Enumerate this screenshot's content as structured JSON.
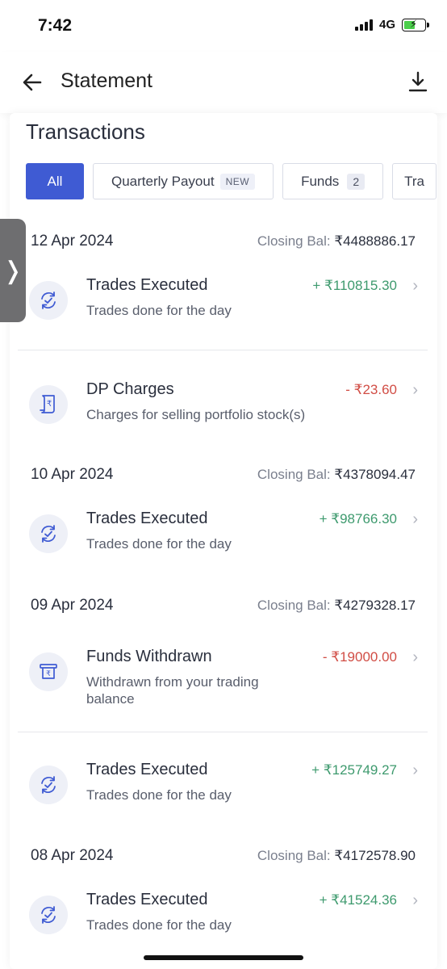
{
  "status": {
    "time": "7:42",
    "network": "4G"
  },
  "header": {
    "title": "Statement"
  },
  "section": {
    "title": "Transactions"
  },
  "filters": [
    {
      "label": "All"
    },
    {
      "label": "Quarterly Payout",
      "badge": "NEW"
    },
    {
      "label": "Funds",
      "count": "2"
    },
    {
      "label": "Tra"
    }
  ],
  "groups": [
    {
      "date": "12 Apr 2024",
      "closing_label": "Closing Bal:",
      "closing_value": "₹4488886.17",
      "items": [
        {
          "title": "Trades Executed",
          "subtitle": "Trades done for the day",
          "amount": "+ ₹110815.30",
          "icon": "trades-sync-icon"
        },
        {
          "title": "DP Charges",
          "subtitle": "Charges for selling portfolio stock(s)",
          "amount": "- ₹23.60",
          "icon": "receipt-rupee-icon"
        }
      ]
    },
    {
      "date": "10 Apr 2024",
      "closing_label": "Closing Bal:",
      "closing_value": "₹4378094.47",
      "items": [
        {
          "title": "Trades Executed",
          "subtitle": "Trades done for the day",
          "amount": "+ ₹98766.30",
          "icon": "trades-sync-icon"
        }
      ]
    },
    {
      "date": "09 Apr 2024",
      "closing_label": "Closing Bal:",
      "closing_value": "₹4279328.17",
      "items": [
        {
          "title": "Funds Withdrawn",
          "subtitle": "Withdrawn from your trading balance",
          "amount": "- ₹19000.00",
          "icon": "withdraw-rupee-icon"
        },
        {
          "title": "Trades Executed",
          "subtitle": "Trades done for the day",
          "amount": "+ ₹125749.27",
          "icon": "trades-sync-icon"
        }
      ]
    },
    {
      "date": "08 Apr 2024",
      "closing_label": "Closing Bal:",
      "closing_value": "₹4172578.90",
      "items": [
        {
          "title": "Trades Executed",
          "subtitle": "Trades done for the day",
          "amount": "+ ₹41524.36",
          "icon": "trades-sync-icon"
        }
      ]
    }
  ],
  "colors": {
    "accent": "#3f5bd3",
    "positive": "#3e9a6e",
    "negative": "#d14d45"
  }
}
